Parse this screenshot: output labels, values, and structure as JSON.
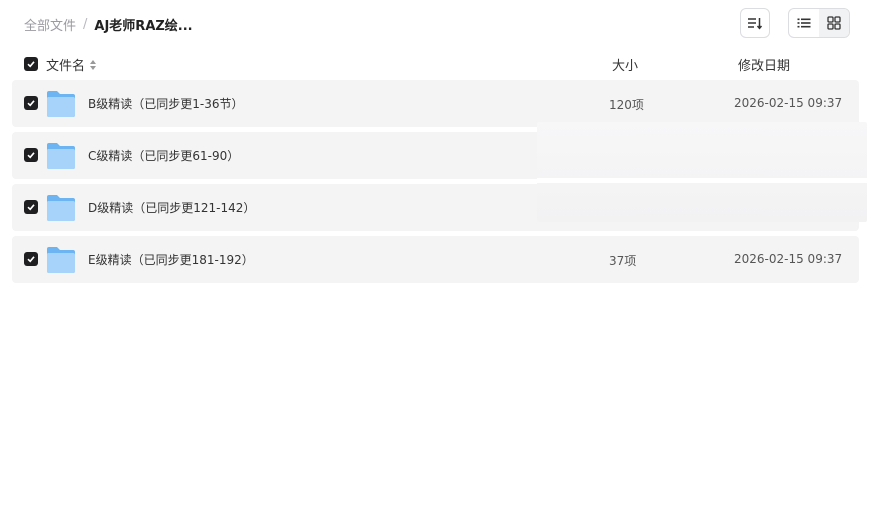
{
  "breadcrumb": {
    "root": "全部文件",
    "separator": "/",
    "current": "AJ老师RAZ绘..."
  },
  "toolbar": {
    "sort_icon": "sort-lines-icon",
    "list_view_icon": "list-view-icon",
    "grid_view_icon": "grid-view-icon",
    "active_view": "list"
  },
  "columns": {
    "name": "文件名",
    "size": "大小",
    "date": "修改日期"
  },
  "rows": [
    {
      "name": "B级精读（已同步更1-36节）",
      "size": "120项",
      "date": "2026-02-15 09:37",
      "checked": true
    },
    {
      "name": "C级精读（已同步更61-90）",
      "size": "",
      "date": "",
      "checked": true
    },
    {
      "name": "D级精读（已同步更121-142）",
      "size": "",
      "date": "",
      "checked": true
    },
    {
      "name": "E级精读（已同步更181-192）",
      "size": "37项",
      "date": "2026-02-15 09:37",
      "checked": true
    }
  ],
  "colors": {
    "checkbox": "#1f1f22",
    "row_bg": "#f4f4f5",
    "folder_light": "#a7d3fb",
    "folder_dark": "#6cb4f2"
  }
}
